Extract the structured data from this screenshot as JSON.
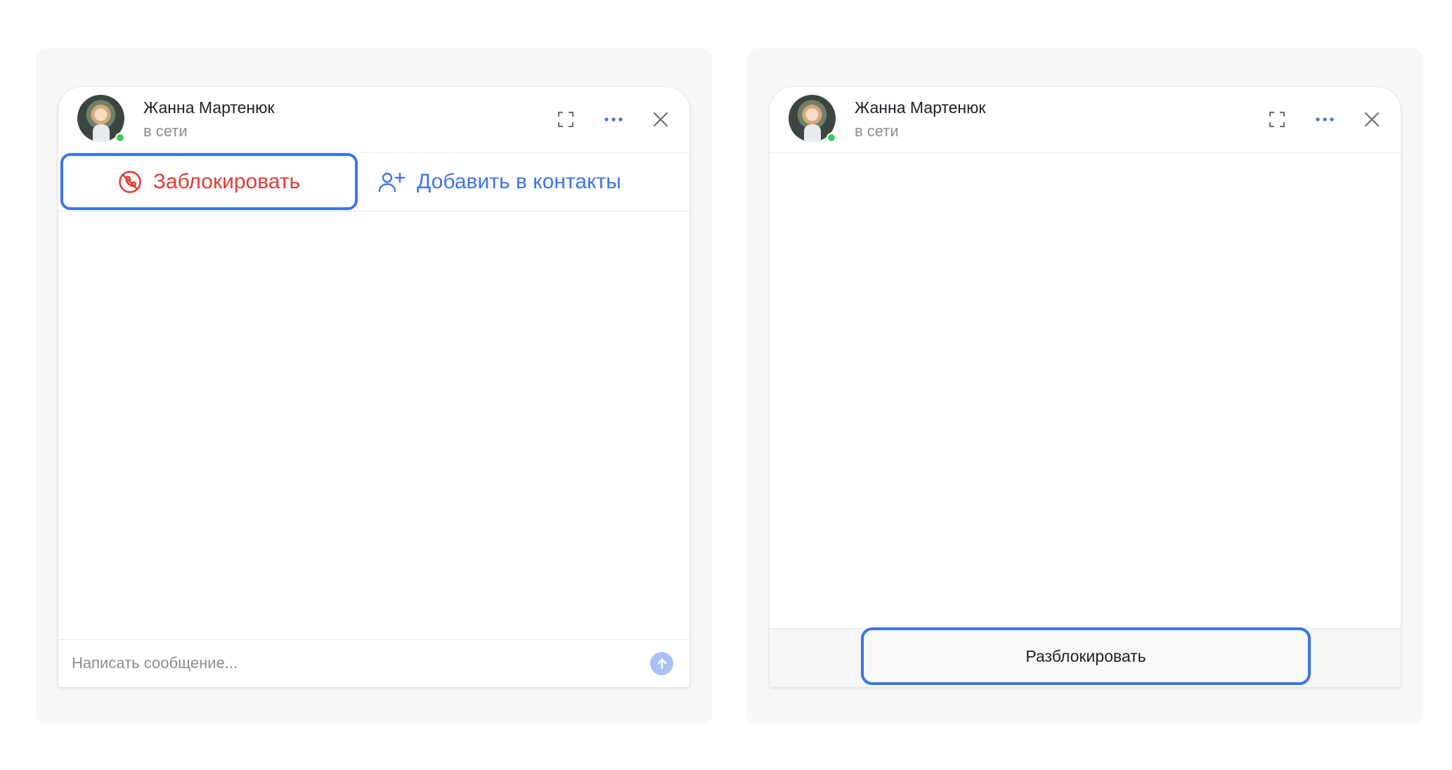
{
  "left_chat": {
    "contact": {
      "name": "Жанна Мартенюк",
      "status": "в сети"
    },
    "actions": {
      "block_label": "Заблокировать",
      "add_contact_label": "Добавить в контакты"
    },
    "composer": {
      "placeholder": "Написать сообщение..."
    }
  },
  "right_chat": {
    "contact": {
      "name": "Жанна Мартенюк",
      "status": "в сети"
    },
    "unblock_label": "Разблокировать"
  },
  "icons": {
    "expand": "expand-icon",
    "more": "more-icon",
    "close": "close-icon",
    "block": "block-icon",
    "add_contact": "add-user-icon",
    "send": "arrow-up-icon"
  },
  "colors": {
    "accent": "#3d74e6",
    "danger": "#e13b36",
    "online": "#3ec663",
    "send_disabled": "#a9c1f5"
  }
}
